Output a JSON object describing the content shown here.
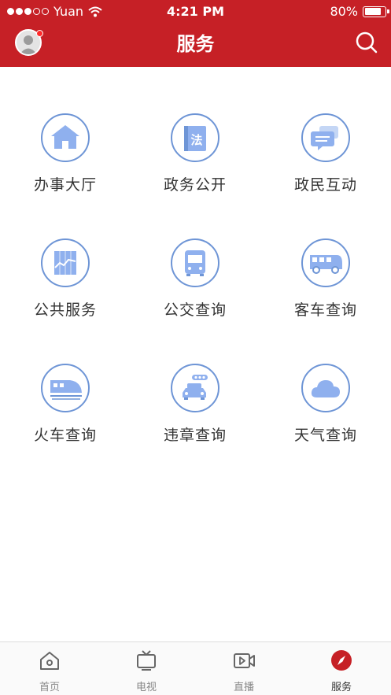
{
  "status_bar": {
    "carrier": "Yuan",
    "time": "4:21 PM",
    "battery": "80%",
    "battery_level": 0.8
  },
  "header": {
    "title": "服务",
    "accent_color": "#c62026"
  },
  "services": [
    {
      "label": "办事大厅",
      "icon": "house-icon"
    },
    {
      "label": "政务公开",
      "icon": "law-book-icon"
    },
    {
      "label": "政民互动",
      "icon": "chat-bubbles-icon"
    },
    {
      "label": "公共服务",
      "icon": "chart-panel-icon"
    },
    {
      "label": "公交查询",
      "icon": "bus-front-icon"
    },
    {
      "label": "客车查询",
      "icon": "coach-bus-icon"
    },
    {
      "label": "火车查询",
      "icon": "train-icon"
    },
    {
      "label": "违章查询",
      "icon": "traffic-car-icon"
    },
    {
      "label": "天气查询",
      "icon": "cloud-icon"
    }
  ],
  "tabbar": {
    "items": [
      {
        "label": "首页",
        "icon": "home-icon",
        "active": false
      },
      {
        "label": "电视",
        "icon": "tv-icon",
        "active": false
      },
      {
        "label": "直播",
        "icon": "live-video-icon",
        "active": false
      },
      {
        "label": "服务",
        "icon": "compass-icon",
        "active": true
      }
    ]
  }
}
